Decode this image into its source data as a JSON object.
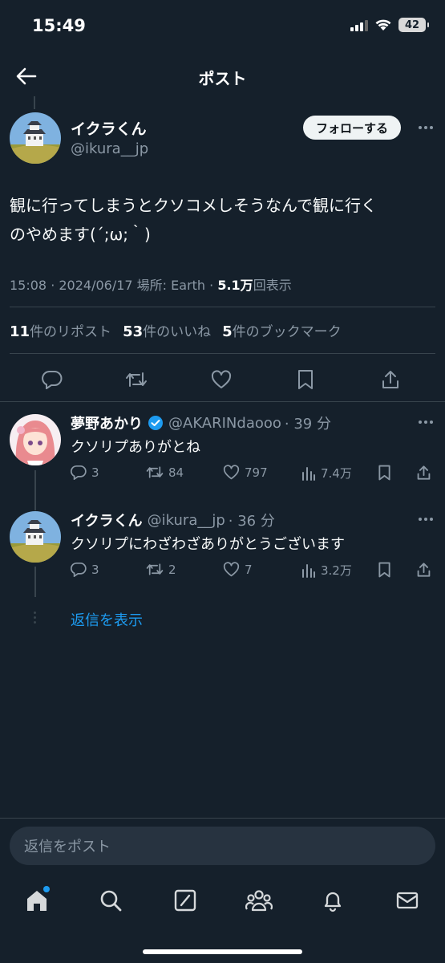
{
  "status": {
    "time": "15:49",
    "battery": "42"
  },
  "header": {
    "title": "ポスト"
  },
  "post": {
    "author_name": "イクラくん",
    "author_handle": "@ikura__jp",
    "follow_label": "フォローする",
    "text_line1": "観に行ってしまうとクソコメしそうなんで観に行く",
    "text_line2": "のやめます(´;ω;｀)",
    "meta_prefix": "15:08 · 2024/06/17 場所: Earth · ",
    "views_value": "5.1万",
    "views_label": "回表示",
    "reposts_count": "11",
    "reposts_label": "件のリポスト",
    "likes_count": "53",
    "likes_label": "件のいいね",
    "bookmarks_count": "5",
    "bookmarks_label": "件のブックマーク"
  },
  "replies": [
    {
      "name": "夢野あかり",
      "verified": true,
      "handle": "@AKARINdaooo",
      "time": "· 39 分",
      "text": "クソリプありがとね",
      "reply_count": "3",
      "repost_count": "84",
      "like_count": "797",
      "view_count": "7.4万"
    },
    {
      "name": "イクラくん",
      "verified": false,
      "handle": "@ikura__jp",
      "time": "· 36 分",
      "text": "クソリプにわざわざありがとうございます",
      "reply_count": "3",
      "repost_count": "2",
      "like_count": "7",
      "view_count": "3.2万"
    }
  ],
  "show_replies_label": "返信を表示",
  "compose": {
    "placeholder": "返信をポスト"
  },
  "colors": {
    "background": "#15202b",
    "accent": "#1d9bf0",
    "secondary_text": "#8b98a5"
  },
  "tabs": [
    "home-icon",
    "search-icon",
    "grok-icon",
    "communities-icon",
    "notifications-icon",
    "messages-icon"
  ]
}
